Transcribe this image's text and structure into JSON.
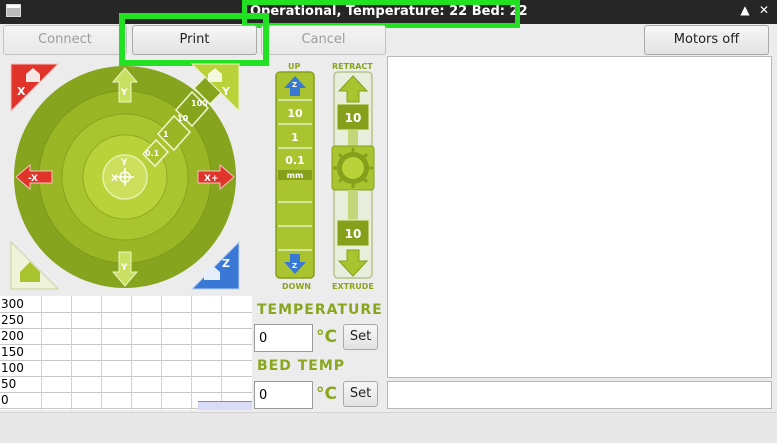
{
  "window": {
    "title": "Operational, Temperature: 22 Bed: 22",
    "maximize_glyph": "▲",
    "close_glyph": "✕"
  },
  "toolbar": {
    "connect_label": "Connect",
    "print_label": "Print",
    "cancel_label": "Cancel",
    "motors_off_label": "Motors off"
  },
  "jog": {
    "x_minus": "-X",
    "x_plus": "X+",
    "y_plus": "Y",
    "y_minus": "Y",
    "center_x": "X",
    "center_y": "Y",
    "home_x": "X",
    "home_y": "Y",
    "home_z": "Z",
    "steps": [
      "0.1",
      "1",
      "10",
      "100"
    ]
  },
  "z_control": {
    "up_label": "UP",
    "down_label": "DOWN",
    "steps": [
      "10",
      "1",
      "0.1"
    ],
    "unit": "mm"
  },
  "extruder": {
    "retract_label": "RETRACT",
    "extrude_label": "EXTRUDE",
    "retract_amount": "10",
    "extrude_amount": "10"
  },
  "graph": {
    "y_ticks": [
      "300",
      "250",
      "200",
      "150",
      "100",
      "50",
      "0"
    ]
  },
  "temperature": {
    "label": "TEMPERATURE",
    "value": "0",
    "unit": "°C",
    "set_label": "Set"
  },
  "bed_temp": {
    "label": "BED TEMP",
    "value": "0",
    "unit": "°C",
    "set_label": "Set"
  },
  "colors": {
    "accent_green": "#8aa61f",
    "highlight": "#22e022",
    "x_axis_red": "#e0342a",
    "z_axis_blue": "#3a78d6"
  }
}
